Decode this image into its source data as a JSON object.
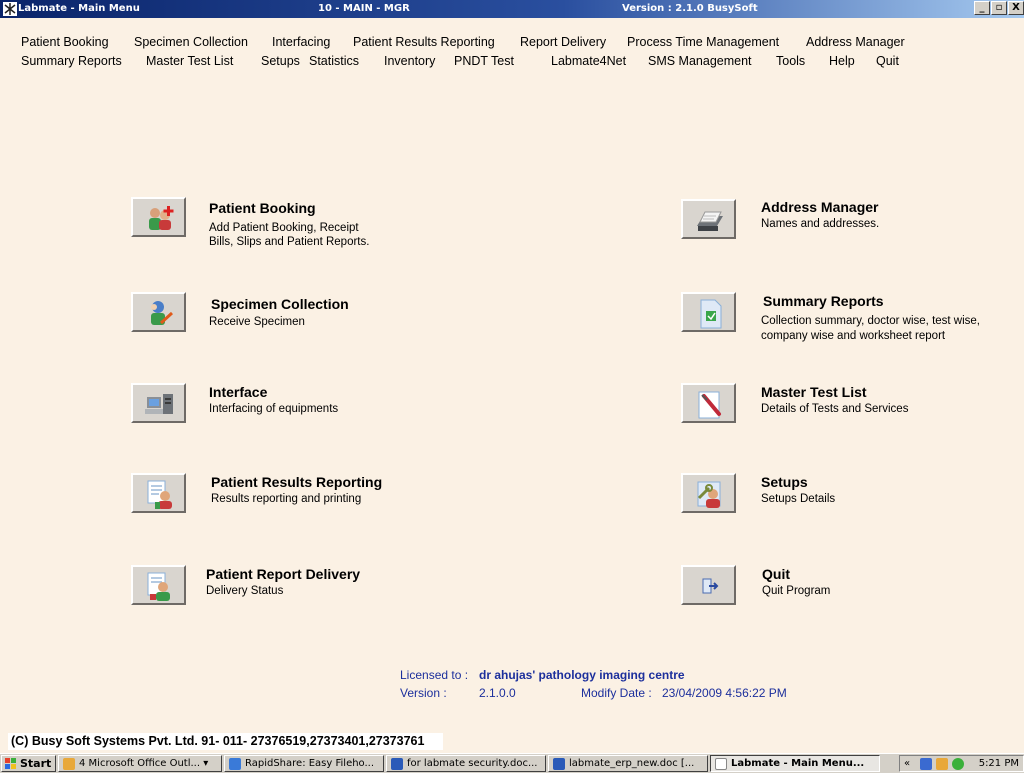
{
  "window": {
    "app_title": "Labmate - Main Menu",
    "center_title": "10 - MAIN - MGR",
    "version_title": "Version : 2.1.0 BusySoft",
    "btn_min": "_",
    "btn_restore": "▫",
    "btn_close": "X"
  },
  "menu_row1": [
    "Patient Booking",
    "Specimen Collection",
    "Interfacing",
    "Patient Results Reporting",
    "Report Delivery",
    "Process Time Management",
    "Address Manager"
  ],
  "menu_row2": [
    "Summary Reports",
    "Master Test List",
    "Setups",
    "Statistics",
    "Inventory",
    "PNDT Test",
    "Labmate4Net",
    "SMS Management",
    "Tools",
    "Help",
    "Quit"
  ],
  "modules": {
    "patient_booking": {
      "title": "Patient Booking",
      "desc1": "Add Patient Booking, Receipt",
      "desc2": "Bills, Slips and Patient Reports.",
      "icon": "patient-booking-icon"
    },
    "specimen_collection": {
      "title": "Specimen Collection",
      "desc1": "Receive Specimen",
      "icon": "specimen-collection-icon"
    },
    "interface": {
      "title": "Interface",
      "desc1": "Interfacing of equipments",
      "icon": "interface-computer-icon"
    },
    "results_reporting": {
      "title": "Patient Results Reporting",
      "desc1": "Results reporting and printing",
      "icon": "results-report-icon"
    },
    "report_delivery": {
      "title": "Patient Report Delivery",
      "desc1": "Delivery Status",
      "icon": "report-delivery-icon"
    },
    "address_manager": {
      "title": "Address Manager",
      "desc1": "Names and addresses.",
      "icon": "rolodex-icon"
    },
    "summary_reports": {
      "title": "Summary Reports",
      "desc1": "Collection summary, doctor wise, test wise,",
      "desc2": "company wise and worksheet report",
      "icon": "summary-document-icon"
    },
    "master_test_list": {
      "title": "Master Test List",
      "desc1": "Details of Tests and Services",
      "icon": "test-tube-icon"
    },
    "setups": {
      "title": "Setups",
      "desc1": "Setups Details",
      "icon": "setup-tools-icon"
    },
    "quit": {
      "title": "Quit",
      "desc1": "Quit Program",
      "icon": "exit-door-icon"
    }
  },
  "license": {
    "licensed_label": "Licensed to :",
    "licensed_value": "dr ahujas' pathology imaging centre",
    "version_label": "Version :",
    "version_value": "2.1.0.0",
    "modify_label": "Modify Date :",
    "modify_value": "23/04/2009 4:56:22 PM"
  },
  "copyright": "(C) Busy Soft Systems Pvt. Ltd.  91- 011- 27376519,27373401,27373761",
  "taskbar": {
    "start": "Start",
    "tasks": [
      "4 Microsoft Office Outl... ▾",
      "RapidShare: Easy Fileho...",
      "for labmate security.doc...",
      "labmate_erp_new.doc [...",
      "Labmate - Main Menu..."
    ],
    "tray_arrows": "«",
    "clock": "5:21 PM"
  },
  "colors": {
    "background": "#fbf1e4",
    "titlebar_start": "#0a246a",
    "titlebar_end": "#a6caf0",
    "license_text": "#1c2f9c"
  }
}
